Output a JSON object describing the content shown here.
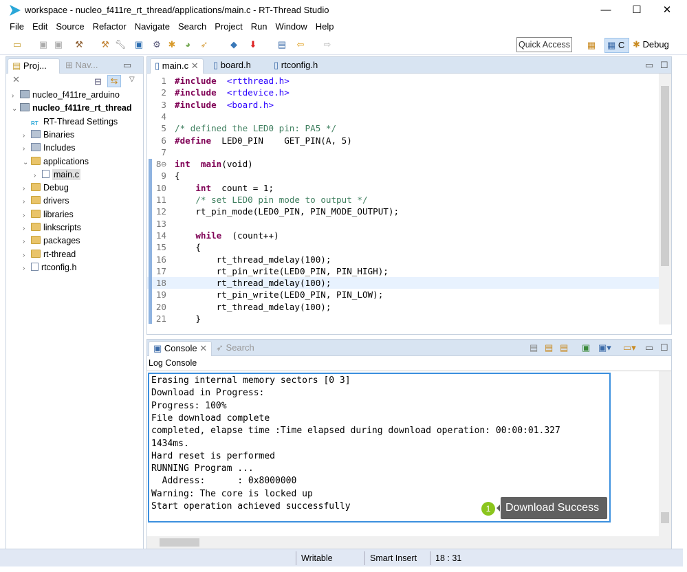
{
  "window": {
    "title": "workspace - nucleo_f411re_rt_thread/applications/main.c - RT-Thread Studio",
    "minimize": "—",
    "maximize": "☐",
    "close": "✕"
  },
  "menu": [
    "File",
    "Edit",
    "Source",
    "Refactor",
    "Navigate",
    "Search",
    "Project",
    "Run",
    "Window",
    "Help"
  ],
  "toolbar": {
    "quick_access": "Quick Access",
    "perspective_c": "C",
    "perspective_debug": "Debug"
  },
  "left_panel": {
    "tabs": [
      {
        "label": "Proj...",
        "active": true
      },
      {
        "label": "Nav...",
        "active": false
      }
    ],
    "tree": [
      {
        "label": "nucleo_f411re_arduino",
        "type": "project",
        "depth": 0,
        "expanded": false
      },
      {
        "label": "nucleo_f411re_rt_thread",
        "type": "project",
        "depth": 0,
        "expanded": true,
        "bold": true
      },
      {
        "label": "RT-Thread Settings",
        "type": "settings",
        "depth": 1
      },
      {
        "label": "Binaries",
        "type": "binaries",
        "depth": 1,
        "expanded": false
      },
      {
        "label": "Includes",
        "type": "includes",
        "depth": 1,
        "expanded": false
      },
      {
        "label": "applications",
        "type": "folder",
        "depth": 1,
        "expanded": true
      },
      {
        "label": "main.c",
        "type": "file",
        "depth": 2,
        "expanded": false,
        "selected": true
      },
      {
        "label": "Debug",
        "type": "folder",
        "depth": 1,
        "expanded": false
      },
      {
        "label": "drivers",
        "type": "folder",
        "depth": 1,
        "expanded": false
      },
      {
        "label": "libraries",
        "type": "folder",
        "depth": 1,
        "expanded": false
      },
      {
        "label": "linkscripts",
        "type": "folder",
        "depth": 1,
        "expanded": false
      },
      {
        "label": "packages",
        "type": "folder",
        "depth": 1,
        "expanded": false
      },
      {
        "label": "rt-thread",
        "type": "folder",
        "depth": 1,
        "expanded": false
      },
      {
        "label": "rtconfig.h",
        "type": "file",
        "depth": 1,
        "expanded": false
      }
    ]
  },
  "editor": {
    "tabs": [
      {
        "label": "main.c",
        "active": true
      },
      {
        "label": "board.h"
      },
      {
        "label": "rtconfig.h"
      }
    ],
    "current_line": 18,
    "lines": [
      [
        [
          "kw",
          "#include"
        ],
        [
          "",
          "  "
        ],
        [
          "str",
          "<rtthread.h>"
        ]
      ],
      [
        [
          "kw",
          "#include"
        ],
        [
          "",
          "  "
        ],
        [
          "str",
          "<rtdevice.h>"
        ]
      ],
      [
        [
          "kw",
          "#include"
        ],
        [
          "",
          "  "
        ],
        [
          "str",
          "<board.h>"
        ]
      ],
      [],
      [
        [
          "cm",
          "/* defined the LED0 pin: PA5 */"
        ]
      ],
      [
        [
          "kw",
          "#define"
        ],
        [
          "",
          "  LED0_PIN    GET_PIN(A, 5)"
        ]
      ],
      [],
      [
        [
          "kw",
          "int"
        ],
        [
          "",
          "  "
        ],
        [
          "kw",
          "main"
        ],
        [
          "",
          "(void)"
        ]
      ],
      [
        [
          "",
          "{"
        ]
      ],
      [
        [
          "",
          "    "
        ],
        [
          "kw",
          "int"
        ],
        [
          "",
          "  count = 1;"
        ]
      ],
      [
        [
          "",
          "    "
        ],
        [
          "cm",
          "/* set LED0 pin mode to output */"
        ]
      ],
      [
        [
          "",
          "    rt_pin_mode(LED0_PIN, PIN_MODE_OUTPUT);"
        ]
      ],
      [],
      [
        [
          "",
          "    "
        ],
        [
          "kw",
          "while"
        ],
        [
          "",
          "  (count++)"
        ]
      ],
      [
        [
          "",
          "    {"
        ]
      ],
      [
        [
          "",
          "        rt_thread_mdelay(100);"
        ]
      ],
      [
        [
          "",
          "        rt_pin_write(LED0_PIN, PIN_HIGH);"
        ]
      ],
      [
        [
          "",
          "        rt_thread_mdelay(100);"
        ]
      ],
      [
        [
          "",
          "        rt_pin_write(LED0_PIN, PIN_LOW);"
        ]
      ],
      [
        [
          "",
          "        rt_thread_mdelay(100);"
        ]
      ],
      [
        [
          "",
          "    }"
        ]
      ]
    ]
  },
  "console": {
    "tabs": [
      {
        "label": "Console",
        "active": true
      },
      {
        "label": "Search"
      }
    ],
    "subtitle": "Log Console",
    "lines": [
      "Erasing internal memory sectors [0 3]",
      "Download in Progress:",
      "Progress: 100%",
      "File download complete",
      "completed, elapse time :Time elapsed during download operation: 00:00:01.327",
      "1434ms.",
      "Hard reset is performed",
      "RUNNING Program ...",
      "  Address:      : 0x8000000",
      "Warning: The core is locked up",
      "Start operation achieved successfully"
    ],
    "badge": "1",
    "tooltip": "Download Success"
  },
  "status": {
    "writable": "Writable",
    "insert_mode": "Smart Insert",
    "position": "18 : 31"
  },
  "colors": {
    "keyword": "#7f0055",
    "string": "#2a00ff",
    "comment": "#3f7f5f",
    "highlight_border": "#3b8fde",
    "badge": "#8bc51d",
    "tooltip_bg": "#606060"
  }
}
